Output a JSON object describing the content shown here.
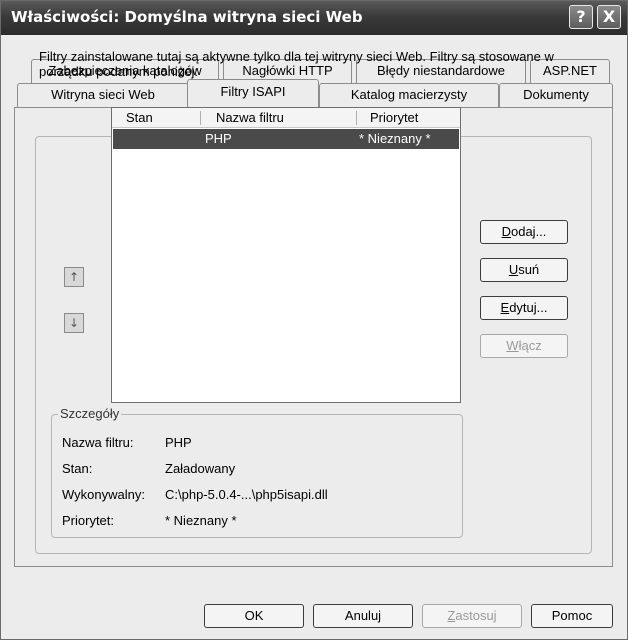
{
  "window": {
    "title": "Właściwości: Domyślna witryna sieci Web",
    "help_glyph": "?",
    "close_glyph": "X"
  },
  "tabs_row1": [
    {
      "label": "Zabezpieczenia katalogów"
    },
    {
      "label": "Nagłówki HTTP"
    },
    {
      "label": "Błędy niestandardowe"
    },
    {
      "label": "ASP.NET"
    }
  ],
  "tabs_row2": [
    {
      "label": "Witryna sieci Web"
    },
    {
      "label": "Filtry ISAPI",
      "active": true
    },
    {
      "label": "Katalog macierzysty"
    },
    {
      "label": "Dokumenty"
    }
  ],
  "panel": {
    "description": "Filtry zainstalowane tutaj są aktywne tylko dla tej witryny sieci Web. Filtry są stosowane w porządku podanym poniżej:",
    "columns": [
      "Stan",
      "Nazwa filtru",
      "Priorytet"
    ],
    "rows": [
      {
        "stan": "",
        "nazwa": "PHP",
        "priorytet": "* Nieznany *"
      }
    ],
    "move_up_glyph": "↑",
    "move_down_glyph": "↓",
    "buttons": {
      "dodaj_pre": "",
      "dodaj_u": "D",
      "dodaj_post": "odaj...",
      "usun_pre": "",
      "usun_u": "U",
      "usun_post": "suń",
      "edytuj_pre": "",
      "edytuj_u": "E",
      "edytuj_post": "dytuj...",
      "wlacz_pre": "",
      "wlacz_u": "W",
      "wlacz_post": "łącz"
    },
    "details": {
      "legend": "Szczegóły",
      "name_label": "Nazwa filtru:",
      "name_value": "PHP",
      "status_label": "Stan:",
      "status_value": "Załadowany",
      "exe_label": "Wykonywalny:",
      "exe_value": "C:\\php-5.0.4-...\\php5isapi.dll",
      "priority_label": "Priorytet:",
      "priority_value": "* Nieznany *"
    }
  },
  "footer": {
    "ok": "OK",
    "cancel": "Anuluj",
    "apply_u": "Z",
    "apply_post": "astosuj",
    "help": "Pomoc"
  }
}
